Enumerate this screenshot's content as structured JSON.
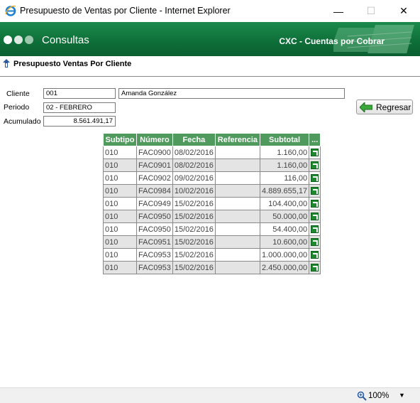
{
  "window": {
    "title": "Presupuesto de Ventas por Cliente - Internet Explorer",
    "minimize": "—",
    "maximize": "☐",
    "close": "✕"
  },
  "banner": {
    "title": "Consultas",
    "module": "CXC - Cuentas por Cobrar"
  },
  "page": {
    "title": "Presupuesto Ventas Por Cliente"
  },
  "form": {
    "cliente_label": "Cliente",
    "cliente_code": "001",
    "cliente_name": "Amanda González",
    "periodo_label": "Periodo",
    "periodo_value": "02 - FEBRERO",
    "acumulado_label": "Acumulado",
    "acumulado_value": "8.561.491,17"
  },
  "buttons": {
    "regresar": "Regresar"
  },
  "table": {
    "headers": [
      "Subtipo",
      "Número",
      "Fecha",
      "Referencia",
      "Subtotal",
      "..."
    ],
    "rows": [
      {
        "subtipo": "010",
        "numero": "FAC0900",
        "fecha": "08/02/2016",
        "referencia": "",
        "subtotal": "1.160,00"
      },
      {
        "subtipo": "010",
        "numero": "FAC0901",
        "fecha": "08/02/2016",
        "referencia": "",
        "subtotal": "1.160,00"
      },
      {
        "subtipo": "010",
        "numero": "FAC0902",
        "fecha": "09/02/2016",
        "referencia": "",
        "subtotal": "116,00"
      },
      {
        "subtipo": "010",
        "numero": "FAC0984",
        "fecha": "10/02/2016",
        "referencia": "",
        "subtotal": "4.889.655,17"
      },
      {
        "subtipo": "010",
        "numero": "FAC0949",
        "fecha": "15/02/2016",
        "referencia": "",
        "subtotal": "104.400,00"
      },
      {
        "subtipo": "010",
        "numero": "FAC0950",
        "fecha": "15/02/2016",
        "referencia": "",
        "subtotal": "50.000,00"
      },
      {
        "subtipo": "010",
        "numero": "FAC0950",
        "fecha": "15/02/2016",
        "referencia": "",
        "subtotal": "54.400,00"
      },
      {
        "subtipo": "010",
        "numero": "FAC0951",
        "fecha": "15/02/2016",
        "referencia": "",
        "subtotal": "10.600,00"
      },
      {
        "subtipo": "010",
        "numero": "FAC0953",
        "fecha": "15/02/2016",
        "referencia": "",
        "subtotal": "1.000.000,00"
      },
      {
        "subtipo": "010",
        "numero": "FAC0953",
        "fecha": "15/02/2016",
        "referencia": "",
        "subtotal": "2.450.000,00"
      }
    ]
  },
  "status": {
    "zoom": "100%",
    "zoom_menu": "▼"
  },
  "colors": {
    "banner_green": "#0e6e38",
    "header_green": "#4f9a5c",
    "row_alt": "#e4e4e4"
  },
  "icons": {
    "browser": "internet-explorer-icon",
    "info": "info-icon",
    "back": "green-back-arrow-icon",
    "row_action": "open-link-icon",
    "zoom": "zoom-magnifier-icon"
  }
}
